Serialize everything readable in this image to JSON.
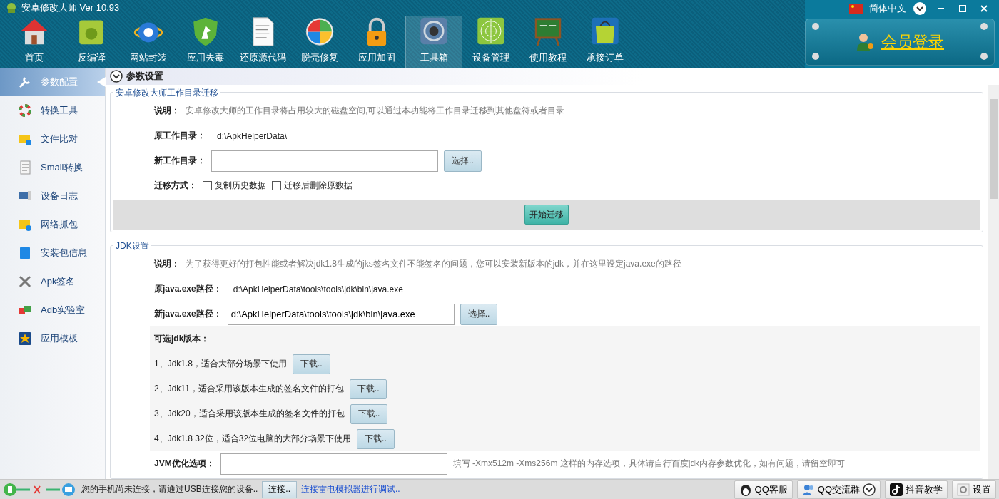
{
  "window": {
    "title": "安卓修改大师 Ver 10.93",
    "language": "简体中文"
  },
  "toolbar": [
    {
      "label": "首页",
      "selected": false
    },
    {
      "label": "反编译",
      "selected": false
    },
    {
      "label": "网站封装",
      "selected": false
    },
    {
      "label": "应用去毒",
      "selected": false
    },
    {
      "label": "还原源代码",
      "selected": false
    },
    {
      "label": "脱壳修复",
      "selected": false
    },
    {
      "label": "应用加固",
      "selected": false
    },
    {
      "label": "工具箱",
      "selected": true
    },
    {
      "label": "设备管理",
      "selected": false
    },
    {
      "label": "使用教程",
      "selected": false
    },
    {
      "label": "承接订单",
      "selected": false
    }
  ],
  "login": {
    "label": "会员登录"
  },
  "sidebar": {
    "items": [
      {
        "label": "参数配置",
        "selected": true
      },
      {
        "label": "转换工具",
        "selected": false
      },
      {
        "label": "文件比对",
        "selected": false
      },
      {
        "label": "Smali转换",
        "selected": false
      },
      {
        "label": "设备日志",
        "selected": false
      },
      {
        "label": "网络抓包",
        "selected": false
      },
      {
        "label": "安装包信息",
        "selected": false
      },
      {
        "label": "Apk签名",
        "selected": false
      },
      {
        "label": "Adb实验室",
        "selected": false
      },
      {
        "label": "应用模板",
        "selected": false
      }
    ]
  },
  "panel": {
    "title": "参数设置"
  },
  "sections": [
    {
      "title": "安卓修改大师工作目录迁移",
      "rows": [
        {
          "kind": "note",
          "label": "说明：",
          "text": "安卓修改大师的工作目录将占用较大的磁盘空间,可以通过本功能将工作目录迁移到其他盘符或者目录"
        },
        {
          "kind": "info",
          "label": "原工作目录：",
          "value": "d:\\ApkHelperData\\"
        },
        {
          "kind": "field",
          "label": "新工作目录：",
          "button": "选择.."
        },
        {
          "kind": "checks",
          "label": "迁移方式：",
          "options": [
            {
              "label": "复制历史数据",
              "checked": false
            },
            {
              "label": "迁移后删除原数据",
              "checked": false
            }
          ]
        },
        {
          "kind": "action",
          "button": "开始迁移"
        }
      ]
    },
    {
      "title": "JDK设置",
      "rows": [
        {
          "kind": "note",
          "label": "说明：",
          "text": "为了获得更好的打包性能或者解决jdk1.8生成的jks签名文件不能签名的问题，您可以安装新版本的jdk，并在这里设定java.exe的路径"
        },
        {
          "kind": "info",
          "label": "原java.exe路径：",
          "value": "d:\\ApkHelperData\\tools\\tools\\jdk\\bin\\java.exe"
        },
        {
          "kind": "field",
          "label": "新java.exe路径：",
          "value": "d:\\ApkHelperData\\tools\\tools\\jdk\\bin\\java.exe",
          "button": "选择.."
        },
        {
          "kind": "heading",
          "label": "可选jdk版本："
        },
        {
          "kind": "download",
          "text": "1、Jdk1.8，适合大部分场景下使用",
          "button": "下载.."
        },
        {
          "kind": "download",
          "text": "2、Jdk11，适合采用该版本生成的签名文件的打包",
          "button": "下载.."
        },
        {
          "kind": "download",
          "text": "3、Jdk20，适合采用该版本生成的签名文件的打包",
          "button": "下载.."
        },
        {
          "kind": "download",
          "text": "4、Jdk1.8 32位，适合32位电脑的大部分场景下使用",
          "button": "下载.."
        },
        {
          "kind": "field",
          "label": "JVM优化选项：",
          "hint": "填写  -Xmx512m -Xms256m 这样的内存选项，具体请自行百度jdk内存参数优化，如有问题，请留空即可"
        }
      ]
    }
  ],
  "status_bar": {
    "message": "您的手机尚未连接，请通过USB连接您的设备..",
    "connect_button": "连接..",
    "link": "连接雷电模拟器进行调试..",
    "buttons": [
      {
        "label": "QQ客服",
        "dropdown": false
      },
      {
        "label": "QQ交流群",
        "dropdown": true
      },
      {
        "label": "抖音教学",
        "dropdown": false
      },
      {
        "label": "设置",
        "dropdown": false
      }
    ]
  }
}
